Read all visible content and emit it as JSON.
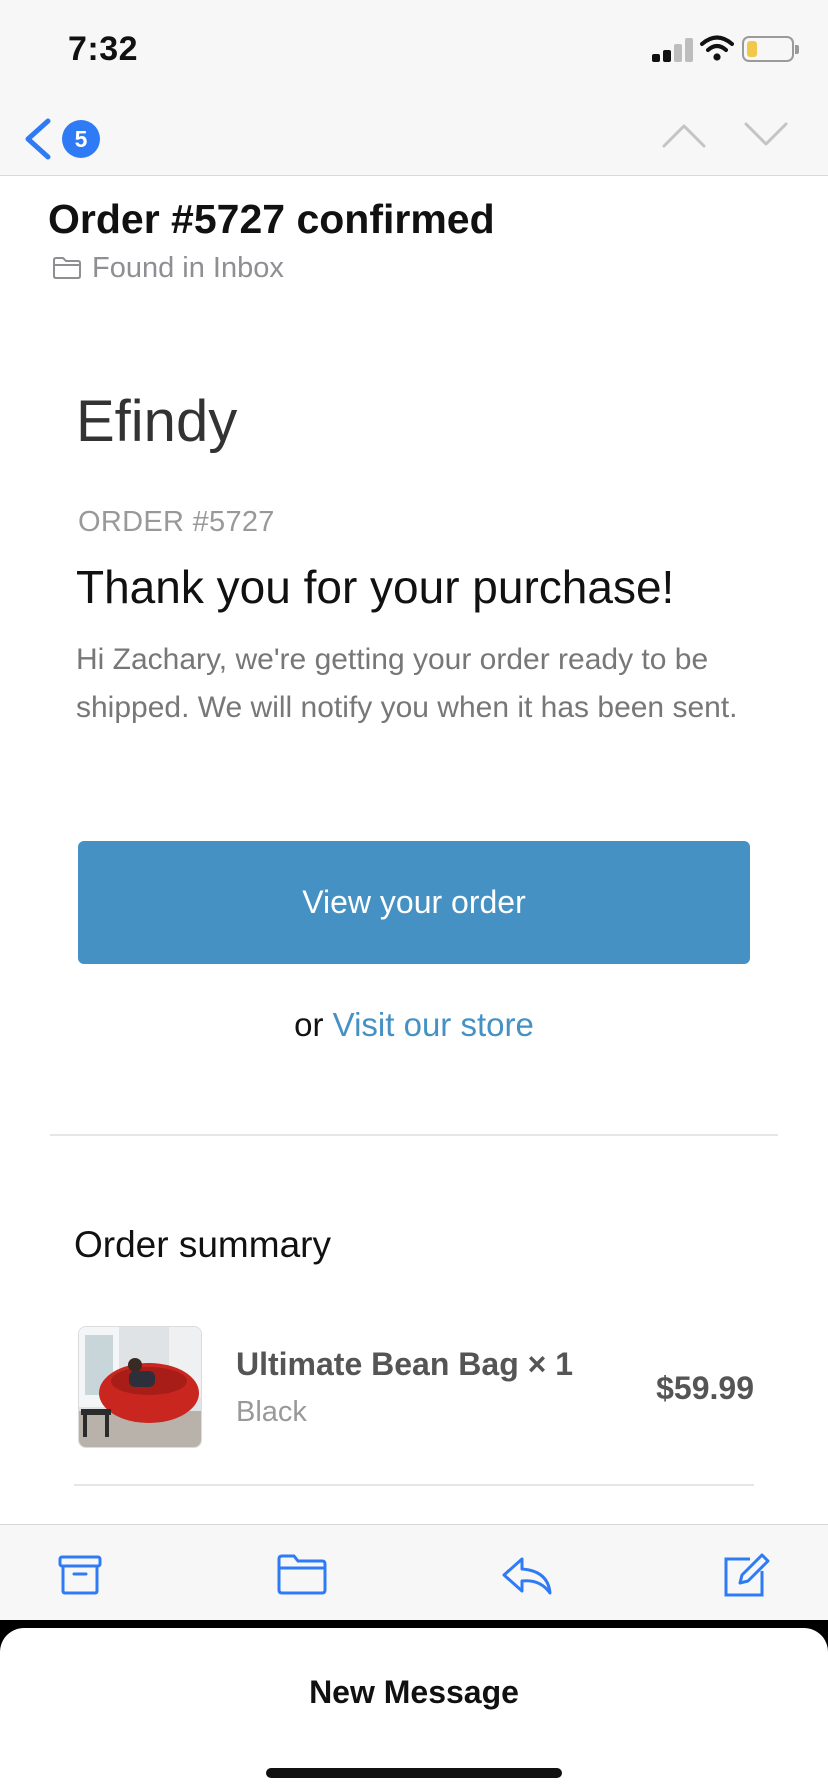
{
  "status_bar": {
    "time": "7:32"
  },
  "nav": {
    "back_count": "5"
  },
  "email": {
    "subject": "Order #5727 confirmed",
    "folder": "Found in Inbox",
    "brand": "Efindy",
    "order_label": "ORDER #5727",
    "thanks": "Thank you for your purchase!",
    "message": "Hi Zachary, we're getting your order ready to be shipped. We will notify you when it has been sent.",
    "view_order_button": "View your order",
    "or_text": "or",
    "store_link": "Visit our store",
    "summary_title": "Order summary",
    "line_item": {
      "name": "Ultimate Bean Bag × 1",
      "variant": "Black",
      "price": "$59.99"
    }
  },
  "toolbar": {
    "icons": [
      "archive-icon",
      "folder-icon",
      "reply-icon",
      "compose-icon"
    ]
  },
  "sheet": {
    "title": "New Message"
  },
  "colors": {
    "accent": "#2f7bf5",
    "button": "#4591c4",
    "link": "#4591c4",
    "battery": "#f1c84b"
  }
}
